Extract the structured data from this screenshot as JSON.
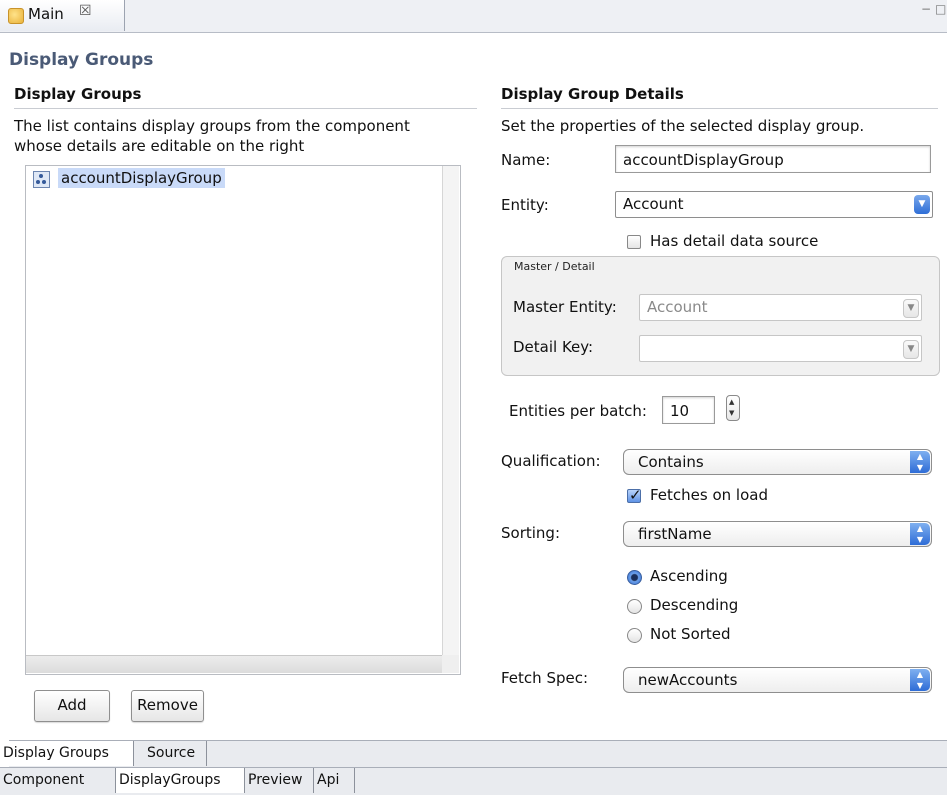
{
  "editor_tab": {
    "label": "Main",
    "close_glyph": "☒"
  },
  "window_controls": {
    "minimize": "−",
    "maximize": "□"
  },
  "page_title": "Display Groups",
  "left": {
    "section_title": "Display Groups",
    "description_line1": "The list contains display groups from the component",
    "description_line2": "whose details are editable on the right",
    "items": [
      {
        "label": "accountDisplayGroup",
        "selected": true
      }
    ],
    "add_label": "Add",
    "remove_label": "Remove"
  },
  "right": {
    "section_title": "Display Group Details",
    "description": "Set the properties of the selected display group.",
    "name_label": "Name:",
    "name_value": "accountDisplayGroup",
    "entity_label": "Entity:",
    "entity_value": "Account",
    "has_detail_label": "Has detail data source",
    "has_detail_checked": false,
    "master_detail": {
      "group_label": "Master / Detail",
      "master_entity_label": "Master Entity:",
      "master_entity_value": "Account",
      "detail_key_label": "Detail Key:",
      "detail_key_value": ""
    },
    "entities_per_batch_label": "Entities per batch:",
    "entities_per_batch_value": "10",
    "qualification_label": "Qualification:",
    "qualification_value": "Contains",
    "fetches_on_load_label": "Fetches on load",
    "fetches_on_load_checked": true,
    "sorting_label": "Sorting:",
    "sorting_value": "firstName",
    "sort_options": [
      {
        "label": "Ascending",
        "selected": true
      },
      {
        "label": "Descending",
        "selected": false
      },
      {
        "label": "Not Sorted",
        "selected": false
      }
    ],
    "fetch_spec_label": "Fetch Spec:",
    "fetch_spec_value": "newAccounts"
  },
  "inner_tabs": [
    {
      "label": "Display Groups",
      "active": true
    },
    {
      "label": "Source",
      "active": false
    }
  ],
  "outer_tabs": [
    {
      "label": "Component",
      "active": false
    },
    {
      "label": "DisplayGroups",
      "active": true
    },
    {
      "label": "Preview",
      "active": false
    },
    {
      "label": "Api",
      "active": false
    }
  ],
  "colors": {
    "title": "#4a5a76",
    "selection": "#c9daf8",
    "combo_arrow": "#2f6ed6"
  }
}
